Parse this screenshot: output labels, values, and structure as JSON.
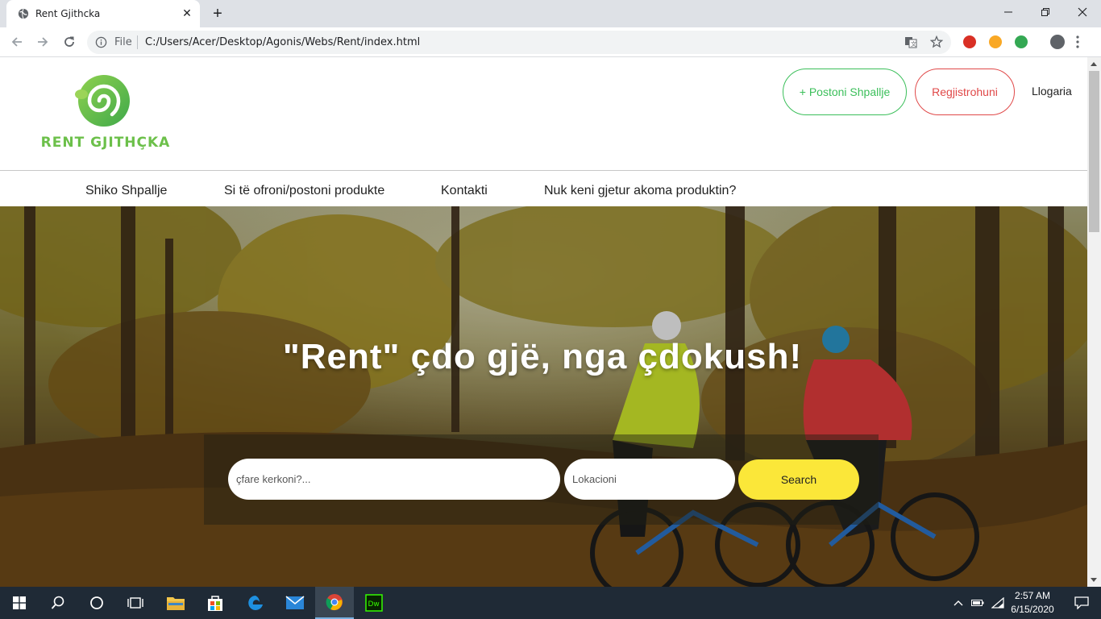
{
  "browser": {
    "tab_title": "Rent Gjithcka",
    "new_tab_label": "+",
    "url_scheme": "File",
    "url": "C:/Users/Acer/Desktop/Agonis/Webs/Rent/index.html"
  },
  "header": {
    "logo_text": "RENT GJITHÇKA",
    "post_button": "+ Postoni Shpallje",
    "register_button": "Regjistrohuni",
    "account_link": "Llogaria"
  },
  "nav": {
    "items": [
      {
        "label": "Shiko Shpallje"
      },
      {
        "label": "Si të ofroni/postoni produkte"
      },
      {
        "label": "Kontakti"
      },
      {
        "label": "Nuk keni gjetur akoma produktin?"
      }
    ]
  },
  "hero": {
    "title": "\"Rent\" çdo gjë, nga çdokush!",
    "search_what_placeholder": "çfare kerkoni?...",
    "search_location_placeholder": "Lokacioni",
    "search_button": "Search"
  },
  "taskbar": {
    "time": "2:57 AM",
    "date": "6/15/2020"
  },
  "colors": {
    "brand_green": "#6cc04a",
    "post_green": "#3bbf5a",
    "register_red": "#e04848",
    "search_yellow": "#fbe739"
  }
}
